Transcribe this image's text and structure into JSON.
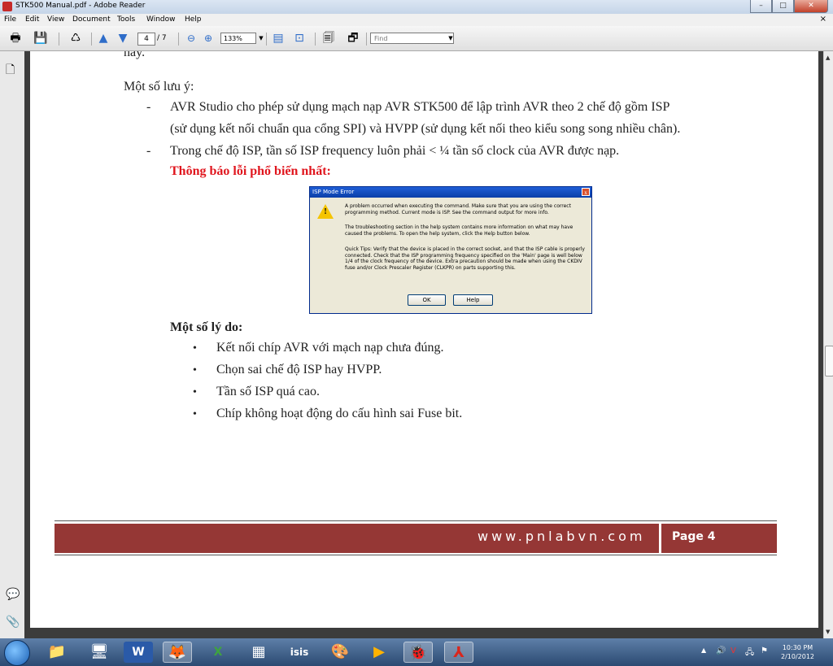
{
  "window": {
    "title": "STK500 Manual.pdf - Adobe Reader",
    "minimize": "–",
    "maximize": "□",
    "close": "✕"
  },
  "menu": {
    "items": [
      "File",
      "Edit",
      "View",
      "Document",
      "Tools",
      "Window",
      "Help"
    ],
    "close_doc": "×"
  },
  "toolbar": {
    "page_current": "4",
    "page_total": "/ 7",
    "zoom": "133%",
    "find_placeholder": "Find"
  },
  "document": {
    "top_cut": "này.",
    "notes_heading": "Một số lưu ý:",
    "dash": "-",
    "note1_line1": "AVR Studio cho phép sử dụng mạch nạp AVR STK500 để lập trình AVR theo 2 chế độ gồm ISP",
    "note1_line2": "(sử dụng kết nối chuẩn qua cổng SPI) và HVPP (sử dụng kết nối theo kiểu song song nhiều chân).",
    "note2": "Trong chế độ ISP, tần số ISP frequency luôn phải < ¼ tần số clock của AVR được nạp.",
    "error_heading": "Thông báo lỗi phổ biến nhất:",
    "reasons_heading": "Một số lý do:",
    "bullet": "•",
    "reasons": [
      "Kết nối chíp AVR với mạch nạp chưa đúng.",
      "Chọn sai chế độ ISP hay HVPP.",
      "Tần số ISP quá cao.",
      "Chíp không hoạt động do cấu hình sai Fuse bit."
    ]
  },
  "dialog": {
    "title": "ISP Mode Error",
    "close": "x",
    "warning_mark": "!",
    "p1": "A problem occurred when executing the command. Make sure that you are using the correct programming method. Current mode is ISP. See the command output for more info.",
    "p2": "The troubleshooting section in the help system contains more information on what may have caused the problems. To open the help system, click the Help button below.",
    "p3": "Quick Tips: Verify that the device is placed in the correct socket, and that the ISP cable is properly connected. Check that the ISP programming frequency specified on the 'Main' page is well below 1/4 of the clock frequency of the device. Extra precaution should be made when using the CKDIV fuse and/or Clock Prescaler Register (CLKPR) on parts supporting this.",
    "ok": "OK",
    "help": "Help"
  },
  "footer": {
    "site": "www.pnlabvn.com",
    "page": "Page 4"
  },
  "taskbar": {
    "clock_time": "10:30 PM",
    "clock_date": "2/10/2012",
    "app_isis": "isis"
  },
  "colors": {
    "footer_bar": "#953735",
    "heading_red": "#e0161e"
  }
}
